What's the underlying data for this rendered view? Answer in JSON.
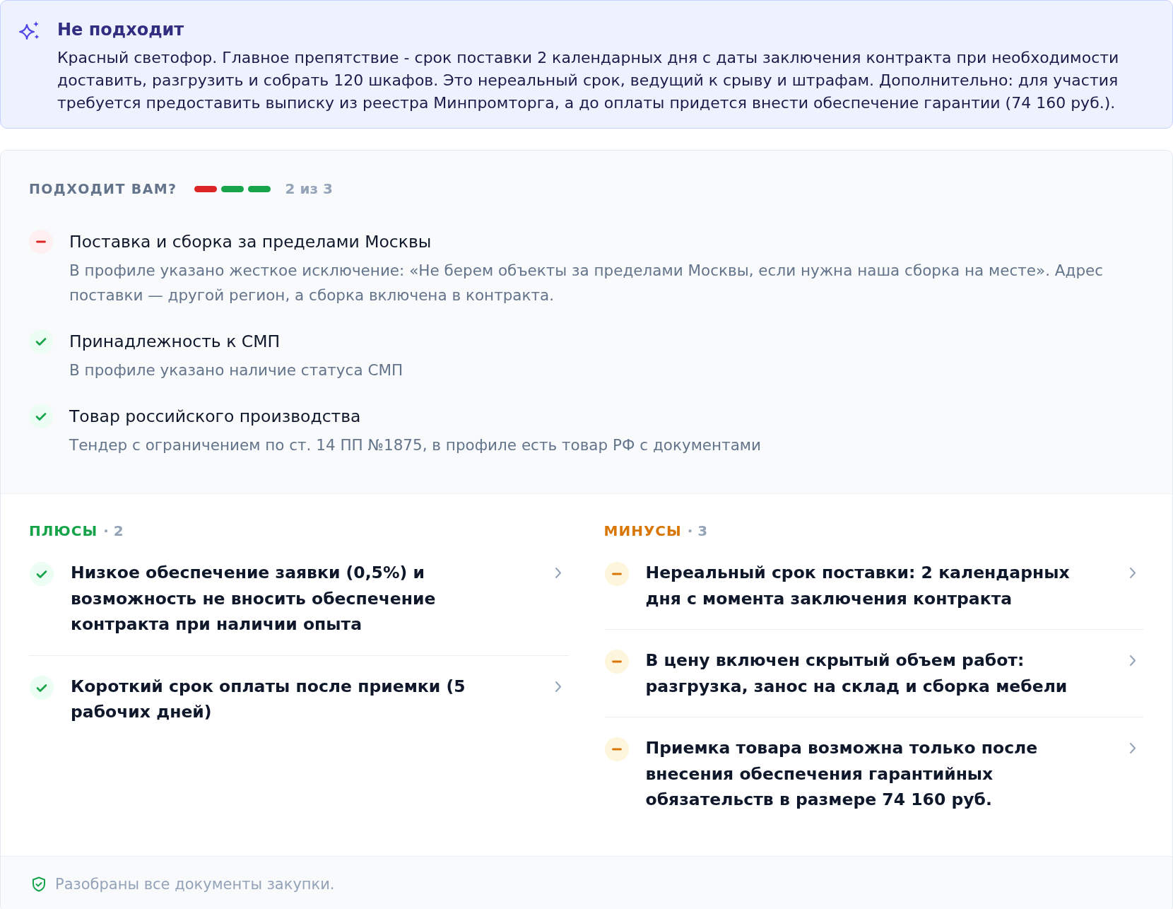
{
  "verdict": {
    "title": "Не подходит",
    "text": "Красный светофор. Главное препятствие - срок поставки 2 календарных дня с даты заключения контракта при необходимости доставить, разгрузить и собрать 120 шкафов. Это нереальный срок, ведущий к срыву и штрафам. Дополнительно: для участия требуется предоставить выписку из реестра Минпромторга, а до оплаты придется внести обеспечение гарантии (74 160 руб.)."
  },
  "fit": {
    "heading": "ПОДХОДИТ ВАМ?",
    "score": "2 из 3",
    "criteria": [
      {
        "title": "Поставка и сборка за пределами Москвы",
        "description": "В профиле указано жесткое исключение: «Не берем объекты за пределами Москвы, если нужна наша сборка на месте». Адрес поставки — другой регион, а сборка включена в контракта.",
        "met": false
      },
      {
        "title": "Принадлежность к СМП",
        "description": "В профиле указано наличие статуса СМП",
        "met": true
      },
      {
        "title": "Товар российского производства",
        "description": "Тендер с ограничением по ст. 14 ПП №1875, в профиле есть товар РФ с документами",
        "met": true
      }
    ]
  },
  "lists": [
    {
      "kind": "pros",
      "heading": "ПЛЮСЫ",
      "count": "· 2",
      "items": [
        {
          "text": "Низкое обеспечение заявки (0,5%) и возможность не вносить обеспечение контракта при наличии опыта"
        },
        {
          "text": "Короткий срок оплаты после приемки (5 рабочих дней)"
        }
      ]
    },
    {
      "kind": "cons",
      "heading": "МИНУСЫ",
      "count": "· 3",
      "items": [
        {
          "text": "Нереальный срок поставки: 2 календарных дня с момента заключения контракта"
        },
        {
          "text": "В цену включен скрытый объем работ: разгрузка, занос на склад и сборка мебели"
        },
        {
          "text": "Приемка товара возможна только после внесения обеспечения гарантийных обязательств в размере 74 160 руб."
        }
      ]
    }
  ],
  "footer": {
    "text": "Разобраны все документы закупки."
  }
}
